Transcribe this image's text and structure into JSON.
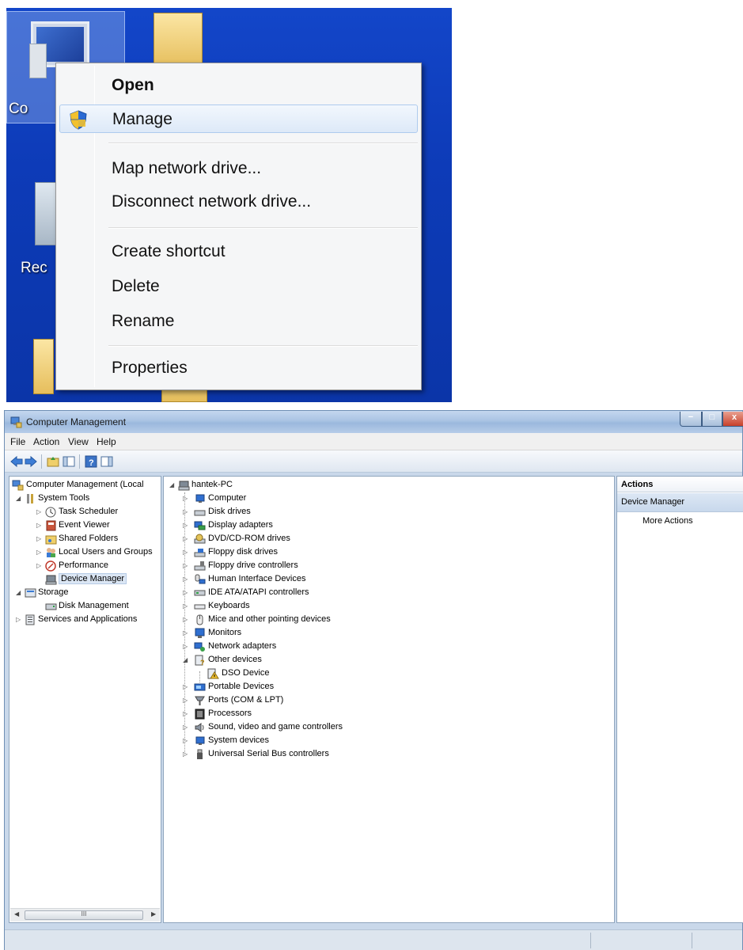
{
  "desktop": {
    "labels": {
      "computer": "Co",
      "recycle": "Rec"
    }
  },
  "context_menu": {
    "items": [
      {
        "label": "Open",
        "bold": true
      },
      {
        "label": "Manage",
        "icon": "uac-shield-icon",
        "highlighted": true
      },
      {
        "label": "Map network drive..."
      },
      {
        "label": "Disconnect network drive..."
      },
      {
        "label": "Create shortcut"
      },
      {
        "label": "Delete"
      },
      {
        "label": "Rename"
      },
      {
        "label": "Properties"
      }
    ]
  },
  "window": {
    "title": "Computer Management",
    "controls": {
      "min": "−",
      "max": "□",
      "close": "x"
    },
    "menu": [
      "File",
      "Action",
      "View",
      "Help"
    ]
  },
  "tree": {
    "items": [
      {
        "label": "Computer Management (Local",
        "icon": "computer-management-icon"
      },
      {
        "label": "System Tools",
        "icon": "tools-icon"
      },
      {
        "label": "Task Scheduler",
        "icon": "clock-icon"
      },
      {
        "label": "Event Viewer",
        "icon": "event-viewer-icon"
      },
      {
        "label": "Shared Folders",
        "icon": "shared-folder-icon"
      },
      {
        "label": "Local Users and Groups",
        "icon": "users-icon"
      },
      {
        "label": "Performance",
        "icon": "performance-icon"
      },
      {
        "label": "Device Manager",
        "icon": "device-manager-icon",
        "selected": true
      },
      {
        "label": "Storage",
        "icon": "storage-icon"
      },
      {
        "label": "Disk Management",
        "icon": "disk-icon"
      },
      {
        "label": "Services and Applications",
        "icon": "services-icon"
      }
    ],
    "scrollbar": {
      "thumb": "III"
    }
  },
  "devices": {
    "root": "hantek-PC",
    "items": [
      {
        "label": "Computer",
        "icon": "computer-icon"
      },
      {
        "label": "Disk drives",
        "icon": "disk-drive-icon"
      },
      {
        "label": "Display adapters",
        "icon": "display-adapter-icon"
      },
      {
        "label": "DVD/CD-ROM drives",
        "icon": "dvd-drive-icon"
      },
      {
        "label": "Floppy disk drives",
        "icon": "floppy-icon"
      },
      {
        "label": "Floppy drive controllers",
        "icon": "floppy-controller-icon"
      },
      {
        "label": "Human Interface Devices",
        "icon": "hid-icon"
      },
      {
        "label": "IDE ATA/ATAPI controllers",
        "icon": "ide-controller-icon"
      },
      {
        "label": "Keyboards",
        "icon": "keyboard-icon"
      },
      {
        "label": "Mice and other pointing devices",
        "icon": "mouse-icon"
      },
      {
        "label": "Monitors",
        "icon": "monitor-icon"
      },
      {
        "label": "Network adapters",
        "icon": "network-adapter-icon"
      },
      {
        "label": "Other devices",
        "icon": "other-devices-icon",
        "expanded": true
      },
      {
        "label": "DSO Device",
        "icon": "warning-device-icon",
        "child": true
      },
      {
        "label": "Portable Devices",
        "icon": "portable-device-icon"
      },
      {
        "label": "Ports (COM & LPT)",
        "icon": "port-icon"
      },
      {
        "label": "Processors",
        "icon": "processor-icon"
      },
      {
        "label": "Sound, video and game controllers",
        "icon": "sound-icon"
      },
      {
        "label": "System devices",
        "icon": "system-device-icon"
      },
      {
        "label": "Universal Serial Bus controllers",
        "icon": "usb-icon"
      }
    ]
  },
  "actions": {
    "header": "Actions",
    "section": "Device Manager",
    "more": "More Actions"
  },
  "colors": {
    "desktop_blue": "#1346c9",
    "menu_highlight": "#dde9f8",
    "window_frame": "#c9d8ea"
  }
}
